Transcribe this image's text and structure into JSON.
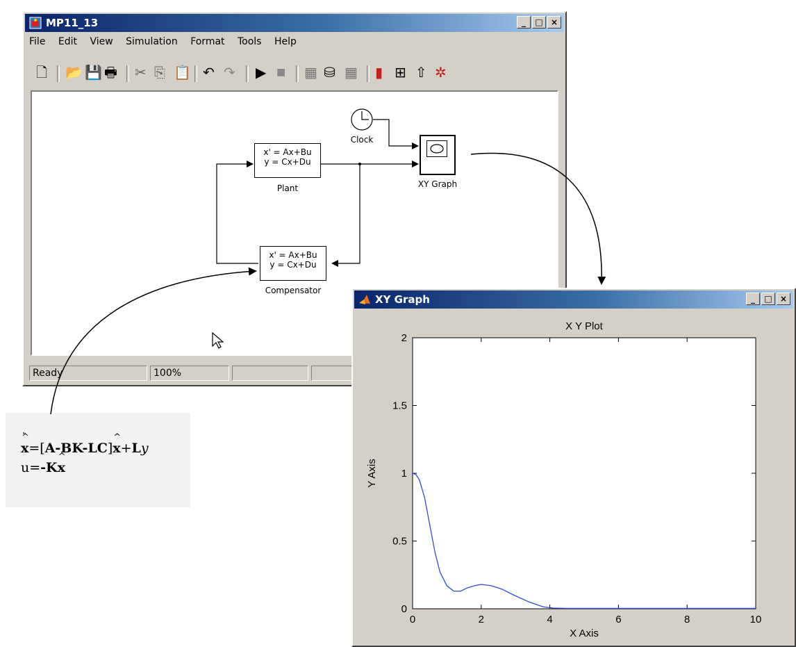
{
  "sim_window": {
    "title": "MP11_13",
    "menu": [
      "File",
      "Edit",
      "View",
      "Simulation",
      "Format",
      "Tools",
      "Help"
    ],
    "status": {
      "text": "Ready",
      "zoom": "100%"
    },
    "blocks": {
      "plant": {
        "line1": "x' = Ax+Bu",
        "line2": "y = Cx+Du",
        "label": "Plant"
      },
      "compensator": {
        "line1": "x' = Ax+Bu",
        "line2": "y = Cx+Du",
        "label": "Compensator"
      },
      "clock": {
        "label": "Clock"
      },
      "xygraph": {
        "label": "XY Graph"
      }
    }
  },
  "equations": {
    "line1_a": "x",
    "line1_b": "=[",
    "line1_c": "A-BK-LC",
    "line1_d": "]",
    "line1_e": "x",
    "line1_f": "+",
    "line1_g": "L",
    "line1_h": "y",
    "line2_a": "u=",
    "line2_b": "-K",
    "line2_c": "x"
  },
  "xy_window": {
    "title": "XY Graph"
  },
  "chart_data": {
    "type": "line",
    "title": "X Y Plot",
    "xlabel": "X Axis",
    "ylabel": "Y Axis",
    "xlim": [
      0,
      10
    ],
    "ylim": [
      0,
      2
    ],
    "xticks": [
      "0",
      "2",
      "4",
      "6",
      "8",
      "10"
    ],
    "yticks": [
      "0",
      "0.5",
      "1",
      "1.5",
      "2"
    ],
    "line_color": "#2a4bd7",
    "series": [
      {
        "x": [
          0,
          0.1,
          0.2,
          0.35,
          0.5,
          0.65,
          0.8,
          1.0,
          1.2,
          1.4,
          1.6,
          1.8,
          2.0,
          2.3,
          2.6,
          3.0,
          3.4,
          3.8,
          4.1,
          4.5,
          5,
          6,
          7,
          8,
          9,
          10
        ],
        "y": [
          1.0,
          0.99,
          0.95,
          0.82,
          0.62,
          0.42,
          0.27,
          0.17,
          0.13,
          0.13,
          0.155,
          0.17,
          0.18,
          0.17,
          0.145,
          0.095,
          0.05,
          0.015,
          0.005,
          0.003,
          0.003,
          0.003,
          0.003,
          0.003,
          0.003,
          0.003
        ]
      }
    ]
  }
}
